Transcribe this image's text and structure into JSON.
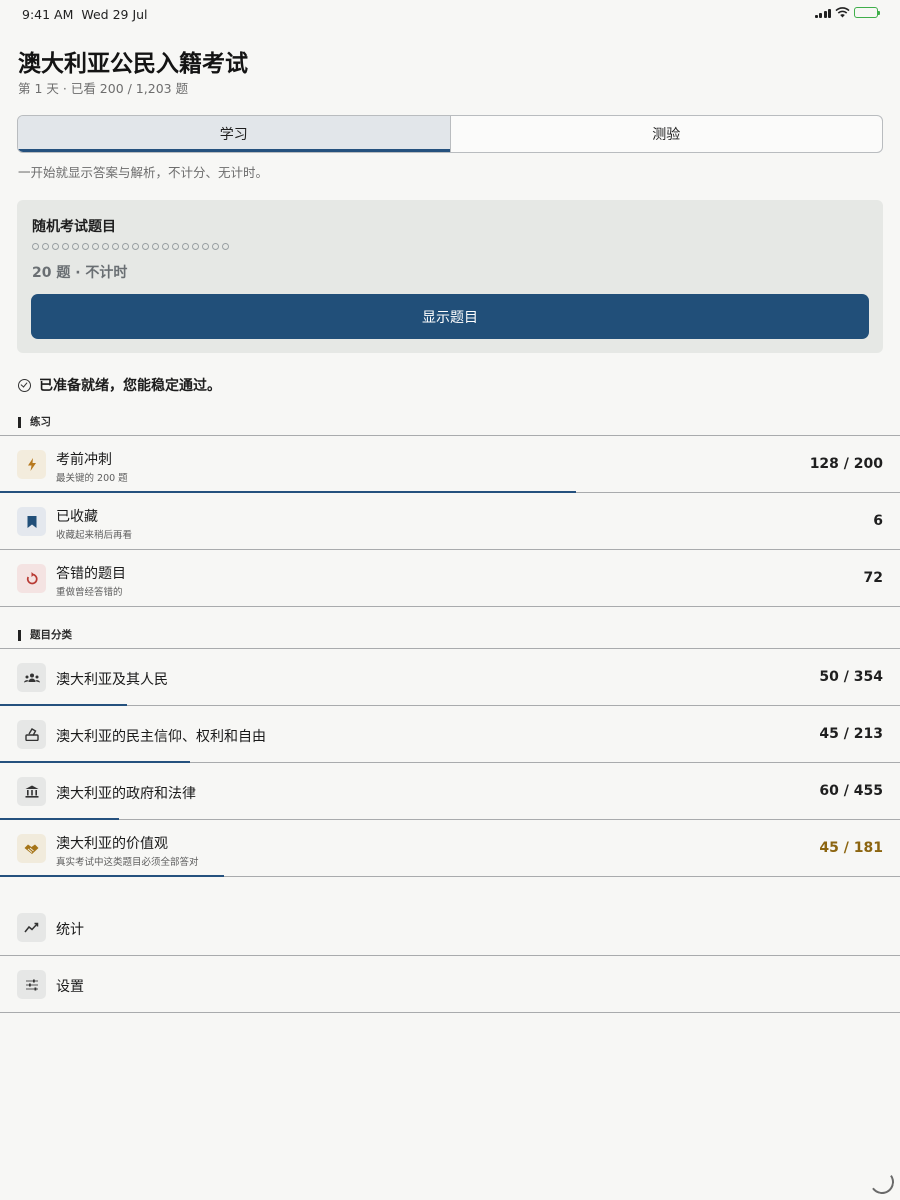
{
  "status_bar": {
    "time": "9:41 AM",
    "date": "Wed 29 Jul"
  },
  "header": {
    "title": "澳大利亚公民入籍考试",
    "subtitle": "第 1 天 · 已看 200 / 1,203 题"
  },
  "mode_tabs": {
    "items": [
      {
        "label": "学习",
        "active": true
      },
      {
        "label": "测验",
        "active": false
      }
    ],
    "description": "一开始就显示答案与解析，不计分、无计时。"
  },
  "random_card": {
    "title": "随机考试题目",
    "dot_count": 20,
    "meta": "20 题 · 不计时",
    "button_label": "显示题目"
  },
  "readiness": {
    "text": "已准备就绪，您能稳定通过。"
  },
  "practice": {
    "label": "练习",
    "items": [
      {
        "title": "考前冲刺",
        "subtitle": "最关键的 200 题",
        "count": "128 / 200",
        "progress": 0.64,
        "icon": "lightning-icon",
        "icon_bg": "#f3ecdd",
        "icon_color": "#b7791f"
      },
      {
        "title": "已收藏",
        "subtitle": "收藏起来稍后再看",
        "count": "6",
        "icon": "bookmark-icon",
        "icon_bg": "#e4e8ee",
        "icon_color": "#214f79"
      },
      {
        "title": "答错的题目",
        "subtitle": "重做曾经答错的",
        "count": "72",
        "icon": "retry-icon",
        "icon_bg": "#f4e3e2",
        "icon_color": "#b83a33"
      }
    ]
  },
  "categories": {
    "label": "题目分类",
    "items": [
      {
        "title": "澳大利亚及其人民",
        "count": "50 / 354",
        "progress": 0.141,
        "icon": "people-icon",
        "gold": false
      },
      {
        "title": "澳大利亚的民主信仰、权利和自由",
        "count": "45 / 213",
        "progress": 0.211,
        "icon": "ballot-icon",
        "gold": false
      },
      {
        "title": "澳大利亚的政府和法律",
        "count": "60 / 455",
        "progress": 0.132,
        "icon": "government-icon",
        "gold": false
      },
      {
        "title": "澳大利亚的价值观",
        "subtitle": "真实考试中这类题目必须全部答对",
        "count": "45 / 181",
        "progress": 0.249,
        "icon": "handshake-icon",
        "gold": true
      }
    ]
  },
  "bottom_nav": {
    "items": [
      {
        "title": "统计",
        "icon": "stats-icon"
      },
      {
        "title": "设置",
        "icon": "sliders-icon"
      }
    ]
  },
  "colors": {
    "accent": "#214f79",
    "gold": "#8c6510",
    "card_bg": "#e6e8e5",
    "page_bg": "#f7f7f5"
  }
}
